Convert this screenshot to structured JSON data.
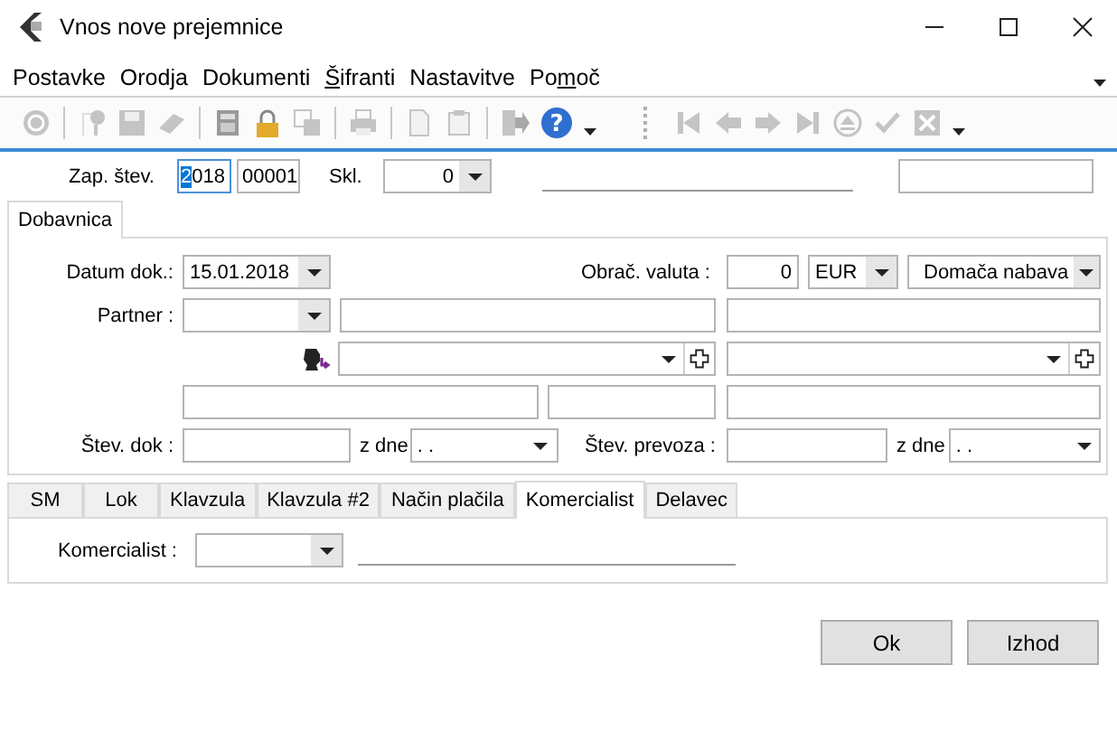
{
  "window": {
    "title": "Vnos nove prejemnice"
  },
  "menu": [
    {
      "label": "Postavke"
    },
    {
      "label": "Orodja"
    },
    {
      "label": "Dokumenti"
    },
    {
      "key": "Š",
      "post": "ifranti"
    },
    {
      "label": "Nastavitve"
    },
    {
      "pre": "Po",
      "key": "m",
      "post": "oč"
    }
  ],
  "toolbar": [
    {
      "kind": "refresh",
      "disabled": true
    },
    {
      "kind": "sep"
    },
    {
      "kind": "pin",
      "disabled": true
    },
    {
      "kind": "save",
      "disabled": true
    },
    {
      "kind": "eraser",
      "disabled": true
    },
    {
      "kind": "sep"
    },
    {
      "kind": "calculator",
      "disabled": true
    },
    {
      "kind": "lock",
      "disabled": false
    },
    {
      "kind": "copy",
      "disabled": true
    },
    {
      "kind": "sep"
    },
    {
      "kind": "printer",
      "disabled": true
    },
    {
      "kind": "sep"
    },
    {
      "kind": "document",
      "disabled": true
    },
    {
      "kind": "paste",
      "disabled": true
    },
    {
      "kind": "sep"
    },
    {
      "kind": "exit",
      "disabled": true
    },
    {
      "kind": "help",
      "glyph": "?",
      "disabled": false
    },
    {
      "kind": "more"
    },
    {
      "kind": "grip"
    },
    {
      "kind": "first",
      "disabled": true
    },
    {
      "kind": "previous",
      "disabled": true
    },
    {
      "kind": "next",
      "disabled": true
    },
    {
      "kind": "last",
      "disabled": true
    },
    {
      "kind": "eject",
      "disabled": true
    },
    {
      "kind": "check",
      "disabled": true
    },
    {
      "kind": "cancel",
      "disabled": true
    },
    {
      "kind": "more"
    }
  ],
  "header": {
    "label": "Zap. štev.",
    "year_selected": "2",
    "year_rest": "018",
    "number": "00001",
    "skl_label": "Skl.",
    "skl_value": "0"
  },
  "main_tabs": [
    {
      "label": "Dobavnica",
      "selected": true
    }
  ],
  "form": {
    "datum_label": "Datum dok.:",
    "datum": "15.01.2018",
    "valuta_label": "Obrač. valuta :",
    "valuta_value": "0",
    "currency": "EUR",
    "nabava": "Domača nabava",
    "partner_label": "Partner :",
    "stev_dok_label": "Štev. dok :",
    "z_dne_1": "z dne",
    "date_1": ". .",
    "prevoz_label": "Štev. prevoza :",
    "z_dne_2": "z dne",
    "date_2": ". ."
  },
  "bottom_tabs": [
    {
      "label": "SM",
      "selected": false
    },
    {
      "label": "Lok",
      "selected": false
    },
    {
      "label": "Klavzula",
      "selected": false
    },
    {
      "label": "Klavzula #2",
      "selected": false
    },
    {
      "label": "Način plačila",
      "selected": false
    },
    {
      "label": "Komercialist",
      "selected": true
    },
    {
      "label": "Delavec",
      "selected": false
    }
  ],
  "komercialist": {
    "label": "Komercialist :"
  },
  "buttons": [
    "Ok",
    "Izhod"
  ]
}
